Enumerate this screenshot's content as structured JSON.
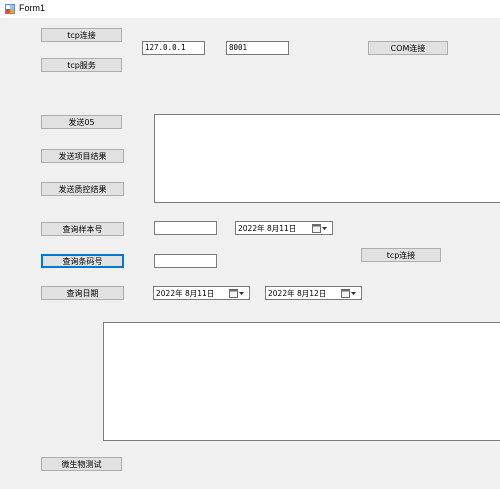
{
  "window": {
    "title": "Form1",
    "icon": "form-app-icon"
  },
  "buttons": {
    "tcp_connect": "tcp连接",
    "tcp_service": "tcp服务",
    "com_connect": "COM连接",
    "send_05": "发送05",
    "send_item_result": "发送项目结果",
    "send_qc_result": "发送质控结果",
    "query_sample_no": "查询样本号",
    "query_barcode": "查询条码号",
    "query_date": "查询日期",
    "tcp_connect_2": "tcp连接",
    "microbe_test": "微生物测试"
  },
  "inputs": {
    "ip_address": "127.0.0.1",
    "port": "8001",
    "sample_no": "",
    "barcode": ""
  },
  "date_pickers": {
    "sample_date": "2022年 8月11日",
    "date_from": "2022年 8月11日",
    "date_to": "2022年 8月12日"
  },
  "icons": {
    "calendar": "calendar-icon",
    "dropdown": "chevron-down-icon"
  }
}
